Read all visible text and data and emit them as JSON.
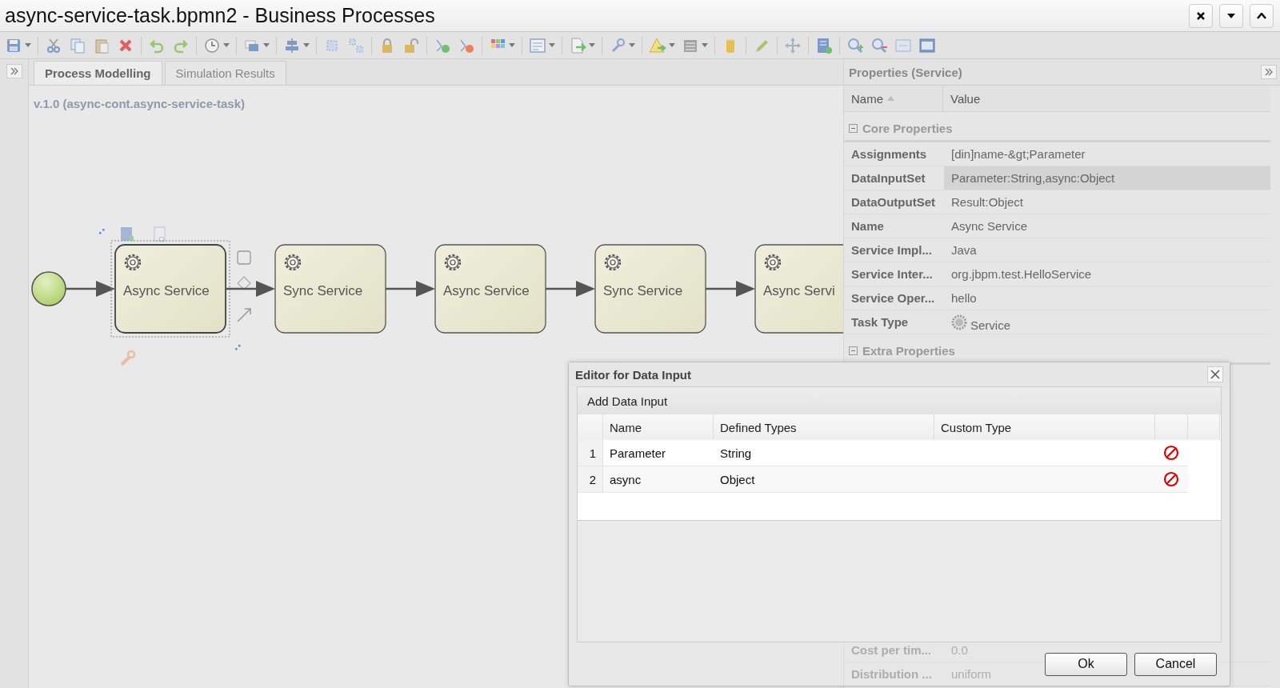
{
  "window": {
    "title": "async-service-task.bpmn2 - Business Processes"
  },
  "tabs": [
    {
      "label": "Process Modelling",
      "selected": true
    },
    {
      "label": "Simulation Results",
      "selected": false
    }
  ],
  "canvas": {
    "version_label": "v.1.0 (async-cont.async-service-task)",
    "nodes": [
      {
        "kind": "start"
      },
      {
        "kind": "task",
        "label": "Async Service",
        "selected": true
      },
      {
        "kind": "task",
        "label": "Sync Service",
        "selected": false
      },
      {
        "kind": "task",
        "label": "Async Service",
        "selected": false
      },
      {
        "kind": "task",
        "label": "Sync Service",
        "selected": false
      },
      {
        "kind": "task",
        "label": "Async Servi",
        "selected": false
      }
    ]
  },
  "properties": {
    "title": "Properties (Service)",
    "columns": [
      {
        "label": "Name",
        "sorted": true
      },
      {
        "label": "Value",
        "sorted": false
      }
    ],
    "sections": [
      {
        "title": "Core Properties",
        "expanded": true,
        "rows": [
          {
            "kind": "text",
            "name": "Assignments",
            "value": "[din]name-&gt;Parameter",
            "selected": false
          },
          {
            "kind": "text",
            "name": "DataInputSet",
            "value": "Parameter:String,async:Object",
            "selected": true
          },
          {
            "kind": "text",
            "name": "DataOutputSet",
            "value": "Result:Object",
            "selected": false
          },
          {
            "kind": "text",
            "name": "Name",
            "value": "Async Service",
            "selected": false
          },
          {
            "kind": "text",
            "name": "Service Impl...",
            "value": "Java",
            "selected": false
          },
          {
            "kind": "text",
            "name": "Service Inter...",
            "value": "org.jbpm.test.HelloService",
            "selected": false
          },
          {
            "kind": "text",
            "name": "Service Oper...",
            "value": "hello",
            "selected": false
          },
          {
            "kind": "icon",
            "name": "Task Type",
            "value": "Service",
            "selected": false
          }
        ]
      },
      {
        "title": "Extra Properties",
        "expanded": true
      },
      {
        "rows": [
          {
            "kind": "text",
            "name": "Cost per tim...",
            "value": "0.0",
            "selected": false
          },
          {
            "kind": "text",
            "name": "Distribution ...",
            "value": "uniform",
            "selected": false
          }
        ]
      }
    ]
  },
  "dialog": {
    "title": "Editor for Data Input",
    "panel_title": "Add Data Input",
    "columns": [
      "Name",
      "Defined Types",
      "Custom Type"
    ],
    "rows": [
      {
        "index": "1",
        "name": "Parameter",
        "defined_type": "String"
      },
      {
        "index": "2",
        "name": "async",
        "defined_type": "Object"
      }
    ],
    "buttons": [
      "Ok",
      "Cancel"
    ]
  }
}
